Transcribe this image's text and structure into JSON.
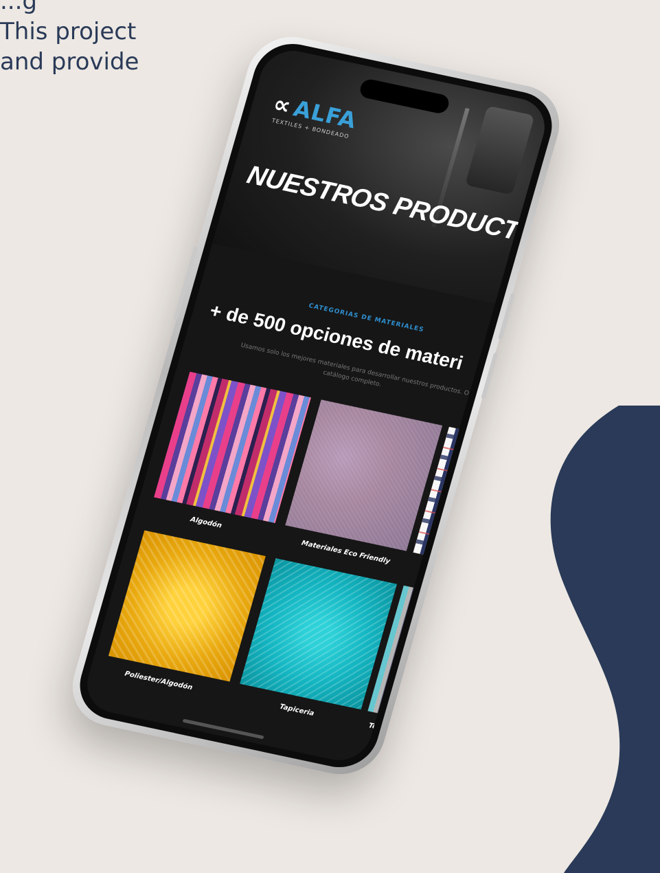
{
  "background_text": [
    "...g",
    "This project",
    "and provide"
  ],
  "colors": {
    "background": "#ede8e3",
    "blob": "#2a3a58",
    "accent": "#3aa0d8"
  },
  "site": {
    "logo_mark": "∝",
    "logo_name": "ALFA",
    "logo_tagline": "TEXTILES + BONDEADO",
    "hero_title": "NUESTROS PRODUCTOS",
    "eyebrow": "CATEGORIAS DE MATERIALES",
    "headline": "+ de 500 opciones de materi",
    "description": "Usamos solo los mejores materiales para desarrollar nuestros productos. O catálogo completo.",
    "categories": [
      {
        "label": "Algodón",
        "texture": "striped-fabric"
      },
      {
        "label": "Materiales Eco Friendly",
        "texture": "woven-lilac"
      },
      {
        "label": "",
        "texture": "tartan"
      },
      {
        "label": "Poliester/Algodón",
        "texture": "yellow-weave"
      },
      {
        "label": "Tapiceria",
        "texture": "teal-weave"
      },
      {
        "label": "Tej",
        "texture": "striped-teal"
      }
    ]
  }
}
